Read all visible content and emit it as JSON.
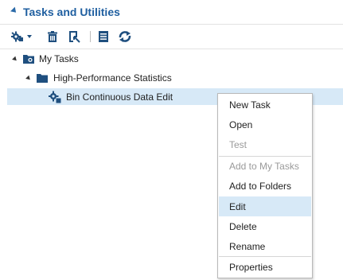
{
  "panel": {
    "title": "Tasks and Utilities"
  },
  "toolbar": {
    "buttons": [
      {
        "icon": "new-task-icon",
        "has_dropdown": true
      },
      {
        "icon": "delete-icon"
      },
      {
        "icon": "properties-icon"
      },
      {
        "icon": "notes-icon"
      },
      {
        "icon": "refresh-icon"
      }
    ]
  },
  "tree": {
    "root": {
      "label": "My Tasks",
      "expanded": true,
      "icon": "my-tasks-folder-icon"
    },
    "folder": {
      "label": "High-Performance Statistics",
      "expanded": true,
      "icon": "folder-icon"
    },
    "item": {
      "label": "Bin Continuous Data Edit",
      "selected": true,
      "icon": "task-icon"
    }
  },
  "context_menu": {
    "items": [
      {
        "label": "New Task",
        "enabled": true
      },
      {
        "label": "Open",
        "enabled": true
      },
      {
        "label": "Test",
        "enabled": false
      },
      {
        "label": "Add to My Tasks",
        "enabled": false
      },
      {
        "label": "Add to Folders",
        "enabled": true
      },
      {
        "label": "Edit",
        "enabled": true,
        "highlighted": true
      },
      {
        "label": "Delete",
        "enabled": true
      },
      {
        "label": "Rename",
        "enabled": true
      },
      {
        "label": "Properties",
        "enabled": true
      }
    ]
  },
  "colors": {
    "accent": "#1f5fa0",
    "selection": "#d7e9f7",
    "disabled_text": "#9a9a9a"
  }
}
